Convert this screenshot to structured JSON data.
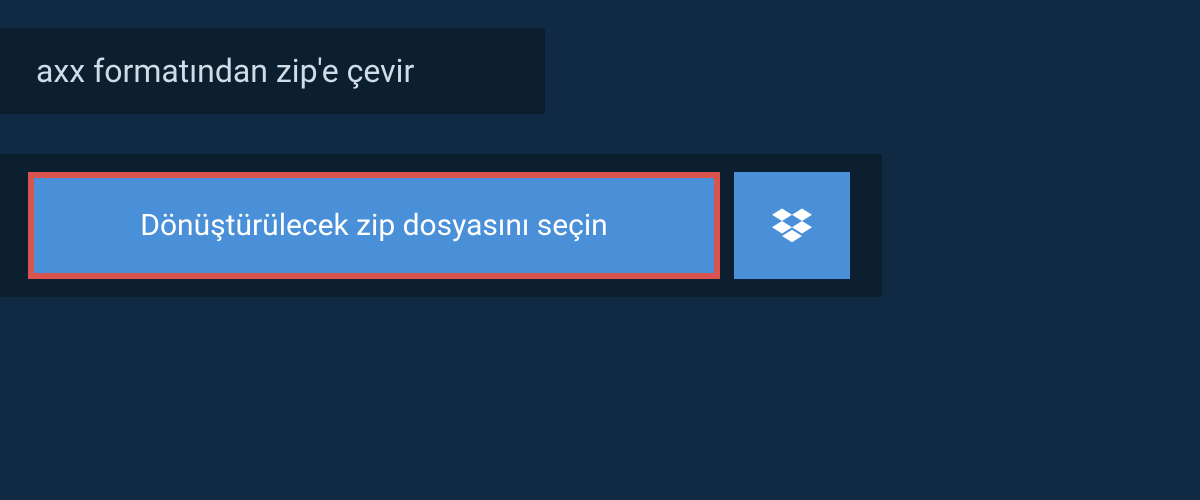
{
  "header": {
    "title": "axx formatından zip'e çevir"
  },
  "actions": {
    "select_file_label": "Dönüştürülecek zip dosyasını seçin",
    "dropbox_label": "Dropbox"
  },
  "colors": {
    "page_bg": "#0f2a42",
    "panel_bg": "#0c1f2f",
    "button_bg": "#4a90d9",
    "highlight_border": "#d9534f",
    "text_light": "#d0dce6",
    "text_white": "#ffffff"
  }
}
